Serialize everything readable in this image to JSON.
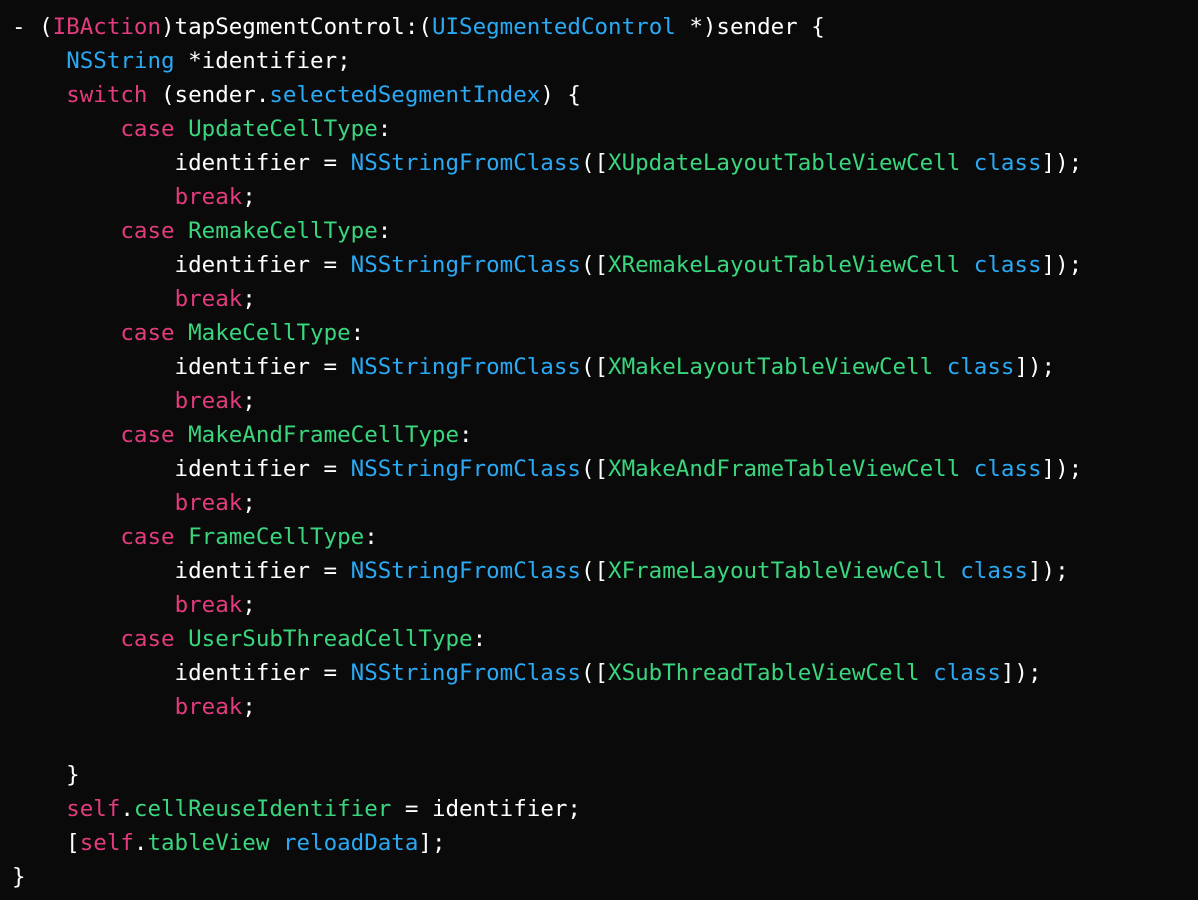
{
  "editor": {
    "language": "Objective-C",
    "background_color": "#0a0a0a",
    "theme_colors": {
      "plain": "#ffffff",
      "keyword": "#e23c7e",
      "type": "#2aa9f5",
      "class_name": "#3ad67e",
      "property": "#3ad67e",
      "function": "#2aa9f5"
    }
  },
  "code": {
    "lines": [
      {
        "id": "line-1",
        "tokens": [
          {
            "text": "- (",
            "kind": "plain"
          },
          {
            "text": "IBAction",
            "kind": "keyword"
          },
          {
            "text": ")tapSegmentControl:(",
            "kind": "plain"
          },
          {
            "text": "UISegmentedControl",
            "kind": "type"
          },
          {
            "text": " *)sender {",
            "kind": "plain"
          }
        ]
      },
      {
        "id": "line-2",
        "tokens": [
          {
            "text": "    ",
            "kind": "plain"
          },
          {
            "text": "NSString",
            "kind": "type"
          },
          {
            "text": " *identifier;",
            "kind": "plain"
          }
        ]
      },
      {
        "id": "line-3",
        "tokens": [
          {
            "text": "    ",
            "kind": "plain"
          },
          {
            "text": "switch",
            "kind": "keyword"
          },
          {
            "text": " (sender.",
            "kind": "plain"
          },
          {
            "text": "selectedSegmentIndex",
            "kind": "type"
          },
          {
            "text": ") {",
            "kind": "plain"
          }
        ]
      },
      {
        "id": "line-4",
        "tokens": [
          {
            "text": "        ",
            "kind": "plain"
          },
          {
            "text": "case",
            "kind": "keyword"
          },
          {
            "text": " ",
            "kind": "plain"
          },
          {
            "text": "UpdateCellType",
            "kind": "class_name"
          },
          {
            "text": ":",
            "kind": "plain"
          }
        ]
      },
      {
        "id": "line-5",
        "tokens": [
          {
            "text": "            identifier = ",
            "kind": "plain"
          },
          {
            "text": "NSStringFromClass",
            "kind": "function"
          },
          {
            "text": "([",
            "kind": "plain"
          },
          {
            "text": "XUpdateLayoutTableViewCell",
            "kind": "class_name"
          },
          {
            "text": " ",
            "kind": "plain"
          },
          {
            "text": "class",
            "kind": "type"
          },
          {
            "text": "]);",
            "kind": "plain"
          }
        ]
      },
      {
        "id": "line-6",
        "tokens": [
          {
            "text": "            ",
            "kind": "plain"
          },
          {
            "text": "break",
            "kind": "keyword"
          },
          {
            "text": ";",
            "kind": "plain"
          }
        ]
      },
      {
        "id": "line-7",
        "tokens": [
          {
            "text": "        ",
            "kind": "plain"
          },
          {
            "text": "case",
            "kind": "keyword"
          },
          {
            "text": " ",
            "kind": "plain"
          },
          {
            "text": "RemakeCellType",
            "kind": "class_name"
          },
          {
            "text": ":",
            "kind": "plain"
          }
        ]
      },
      {
        "id": "line-8",
        "tokens": [
          {
            "text": "            identifier = ",
            "kind": "plain"
          },
          {
            "text": "NSStringFromClass",
            "kind": "function"
          },
          {
            "text": "([",
            "kind": "plain"
          },
          {
            "text": "XRemakeLayoutTableViewCell",
            "kind": "class_name"
          },
          {
            "text": " ",
            "kind": "plain"
          },
          {
            "text": "class",
            "kind": "type"
          },
          {
            "text": "]);",
            "kind": "plain"
          }
        ]
      },
      {
        "id": "line-9",
        "tokens": [
          {
            "text": "            ",
            "kind": "plain"
          },
          {
            "text": "break",
            "kind": "keyword"
          },
          {
            "text": ";",
            "kind": "plain"
          }
        ]
      },
      {
        "id": "line-10",
        "tokens": [
          {
            "text": "        ",
            "kind": "plain"
          },
          {
            "text": "case",
            "kind": "keyword"
          },
          {
            "text": " ",
            "kind": "plain"
          },
          {
            "text": "MakeCellType",
            "kind": "class_name"
          },
          {
            "text": ":",
            "kind": "plain"
          }
        ]
      },
      {
        "id": "line-11",
        "tokens": [
          {
            "text": "            identifier = ",
            "kind": "plain"
          },
          {
            "text": "NSStringFromClass",
            "kind": "function"
          },
          {
            "text": "([",
            "kind": "plain"
          },
          {
            "text": "XMakeLayoutTableViewCell",
            "kind": "class_name"
          },
          {
            "text": " ",
            "kind": "plain"
          },
          {
            "text": "class",
            "kind": "type"
          },
          {
            "text": "]);",
            "kind": "plain"
          }
        ]
      },
      {
        "id": "line-12",
        "tokens": [
          {
            "text": "            ",
            "kind": "plain"
          },
          {
            "text": "break",
            "kind": "keyword"
          },
          {
            "text": ";",
            "kind": "plain"
          }
        ]
      },
      {
        "id": "line-13",
        "tokens": [
          {
            "text": "        ",
            "kind": "plain"
          },
          {
            "text": "case",
            "kind": "keyword"
          },
          {
            "text": " ",
            "kind": "plain"
          },
          {
            "text": "MakeAndFrameCellType",
            "kind": "class_name"
          },
          {
            "text": ":",
            "kind": "plain"
          }
        ]
      },
      {
        "id": "line-14",
        "tokens": [
          {
            "text": "            identifier = ",
            "kind": "plain"
          },
          {
            "text": "NSStringFromClass",
            "kind": "function"
          },
          {
            "text": "([",
            "kind": "plain"
          },
          {
            "text": "XMakeAndFrameTableViewCell",
            "kind": "class_name"
          },
          {
            "text": " ",
            "kind": "plain"
          },
          {
            "text": "class",
            "kind": "type"
          },
          {
            "text": "]);",
            "kind": "plain"
          }
        ]
      },
      {
        "id": "line-15",
        "tokens": [
          {
            "text": "            ",
            "kind": "plain"
          },
          {
            "text": "break",
            "kind": "keyword"
          },
          {
            "text": ";",
            "kind": "plain"
          }
        ]
      },
      {
        "id": "line-16",
        "tokens": [
          {
            "text": "        ",
            "kind": "plain"
          },
          {
            "text": "case",
            "kind": "keyword"
          },
          {
            "text": " ",
            "kind": "plain"
          },
          {
            "text": "FrameCellType",
            "kind": "class_name"
          },
          {
            "text": ":",
            "kind": "plain"
          }
        ]
      },
      {
        "id": "line-17",
        "tokens": [
          {
            "text": "            identifier = ",
            "kind": "plain"
          },
          {
            "text": "NSStringFromClass",
            "kind": "function"
          },
          {
            "text": "([",
            "kind": "plain"
          },
          {
            "text": "XFrameLayoutTableViewCell",
            "kind": "class_name"
          },
          {
            "text": " ",
            "kind": "plain"
          },
          {
            "text": "class",
            "kind": "type"
          },
          {
            "text": "]);",
            "kind": "plain"
          }
        ]
      },
      {
        "id": "line-18",
        "tokens": [
          {
            "text": "            ",
            "kind": "plain"
          },
          {
            "text": "break",
            "kind": "keyword"
          },
          {
            "text": ";",
            "kind": "plain"
          }
        ]
      },
      {
        "id": "line-19",
        "tokens": [
          {
            "text": "        ",
            "kind": "plain"
          },
          {
            "text": "case",
            "kind": "keyword"
          },
          {
            "text": " ",
            "kind": "plain"
          },
          {
            "text": "UserSubThreadCellType",
            "kind": "class_name"
          },
          {
            "text": ":",
            "kind": "plain"
          }
        ]
      },
      {
        "id": "line-20",
        "tokens": [
          {
            "text": "            identifier = ",
            "kind": "plain"
          },
          {
            "text": "NSStringFromClass",
            "kind": "function"
          },
          {
            "text": "([",
            "kind": "plain"
          },
          {
            "text": "XSubThreadTableViewCell",
            "kind": "class_name"
          },
          {
            "text": " ",
            "kind": "plain"
          },
          {
            "text": "class",
            "kind": "type"
          },
          {
            "text": "]);",
            "kind": "plain"
          }
        ]
      },
      {
        "id": "line-21",
        "tokens": [
          {
            "text": "            ",
            "kind": "plain"
          },
          {
            "text": "break",
            "kind": "keyword"
          },
          {
            "text": ";",
            "kind": "plain"
          }
        ]
      },
      {
        "id": "line-22",
        "tokens": [
          {
            "text": "",
            "kind": "plain"
          }
        ]
      },
      {
        "id": "line-23",
        "tokens": [
          {
            "text": "    }",
            "kind": "plain"
          }
        ]
      },
      {
        "id": "line-24",
        "tokens": [
          {
            "text": "    ",
            "kind": "plain"
          },
          {
            "text": "self",
            "kind": "keyword"
          },
          {
            "text": ".",
            "kind": "plain"
          },
          {
            "text": "cellReuseIdentifier",
            "kind": "property"
          },
          {
            "text": " = identifier;",
            "kind": "plain"
          }
        ]
      },
      {
        "id": "line-25",
        "tokens": [
          {
            "text": "    [",
            "kind": "plain"
          },
          {
            "text": "self",
            "kind": "keyword"
          },
          {
            "text": ".",
            "kind": "plain"
          },
          {
            "text": "tableView",
            "kind": "property"
          },
          {
            "text": " ",
            "kind": "plain"
          },
          {
            "text": "reloadData",
            "kind": "function"
          },
          {
            "text": "];",
            "kind": "plain"
          }
        ]
      },
      {
        "id": "line-26",
        "tokens": [
          {
            "text": "}",
            "kind": "plain"
          }
        ]
      }
    ]
  }
}
